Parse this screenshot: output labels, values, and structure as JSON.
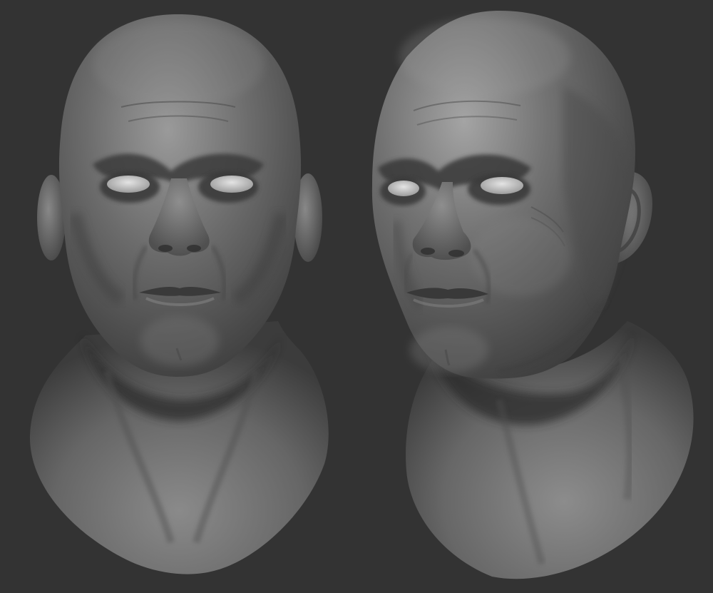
{
  "scene": {
    "background_color": "#333333",
    "material_color": "#6e6e6e",
    "highlight_color": "#bdbdbd",
    "shadow_color": "#2a2a2a",
    "eye_color": "#d6d6d6",
    "subjects": [
      {
        "id": "bust-front",
        "view": "front"
      },
      {
        "id": "bust-three-quarter",
        "view": "three-quarter"
      }
    ]
  }
}
